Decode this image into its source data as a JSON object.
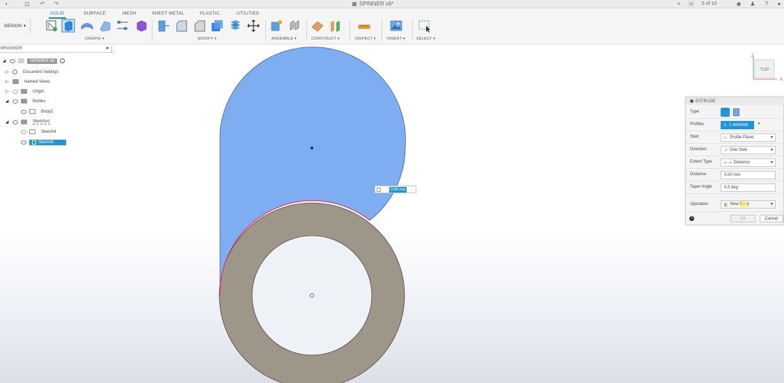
{
  "window": {
    "title": "SPINNER v6*",
    "job_status": "5 of 10"
  },
  "ribbon": {
    "workspace": "DESIGN",
    "tabs": [
      {
        "label": "SOLID",
        "active": true
      },
      {
        "label": "SURFACE",
        "active": false
      },
      {
        "label": "MESH",
        "active": false
      },
      {
        "label": "SHEET METAL",
        "active": false
      },
      {
        "label": "PLASTIC",
        "active": false
      },
      {
        "label": "UTILITIES",
        "active": false
      }
    ],
    "groups": [
      "CREATE ▾",
      "MODIFY ▾",
      "ASSEMBLE ▾",
      "CONSTRUCT ▾",
      "INSPECT ▾",
      "INSERT ▾",
      "SELECT ▾"
    ]
  },
  "browser": {
    "title": "BROWSER",
    "items": [
      {
        "label": "SPINNER v6"
      },
      {
        "label": "Document Settings"
      },
      {
        "label": "Named Views"
      },
      {
        "label": "Origin"
      },
      {
        "label": "Bodies"
      },
      {
        "label": "Body2"
      },
      {
        "label": "Sketches"
      },
      {
        "label": "Sketch4"
      },
      {
        "label": "Sketch6"
      }
    ]
  },
  "extrude": {
    "title": "EXTRUDE",
    "rows": [
      {
        "label": "Type",
        "value": ""
      },
      {
        "label": "Profiles",
        "value": "1 selected"
      },
      {
        "label": "Start",
        "value": "Profile Plane"
      },
      {
        "label": "Direction",
        "value": "One Side"
      },
      {
        "label": "Extent Type",
        "value": "Distance"
      },
      {
        "label": "Distance",
        "value": "0.00 mm"
      },
      {
        "label": "Taper Angle",
        "value": "0.0 deg"
      },
      {
        "label": "Operation",
        "value": "New Body"
      }
    ],
    "ok_label": "OK",
    "cancel_label": "Cancel"
  },
  "viewport": {
    "dimension_value": "0.00 mm",
    "viewcube_face": "TOP",
    "axis_x": "X",
    "axis_z": "Z"
  },
  "colors": {
    "profile_fill": "#7eadf2",
    "body_ring": "#9f968a",
    "body_face": "#eef2f6",
    "highlight": "#1e96d8",
    "edge_select": "#e23a5e"
  }
}
